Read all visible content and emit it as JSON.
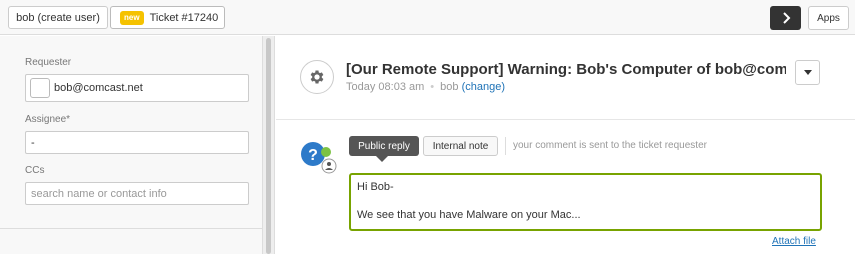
{
  "topbar": {
    "user_tab_label": "bob (create user)",
    "ticket_badge": "new",
    "ticket_tab_label": "Ticket #17240",
    "apps_label": "Apps"
  },
  "sidebar": {
    "requester_label": "Requester",
    "requester_value": "bob@comcast.net",
    "assignee_label": "Assignee*",
    "assignee_value": "-",
    "ccs_label": "CCs",
    "ccs_placeholder": "search name or contact info"
  },
  "ticket": {
    "subject": "[Our Remote Support] Warning: Bob's Computer of bob@comcast.n...",
    "timestamp": "Today 08:03 am",
    "author": "bob",
    "change_link": "(change)"
  },
  "composer": {
    "public_reply_label": "Public reply",
    "internal_note_label": "Internal note",
    "hint": "your comment is sent to the ticket requester",
    "body_line1": "Hi Bob-",
    "body_line2": "We see that you have Malware on your Mac...",
    "attach_label": "Attach file"
  },
  "colors": {
    "accent_green": "#78a300",
    "link_blue": "#1f73b7",
    "badge_yellow": "#f5c200"
  },
  "icons": [
    "chevron-right-icon",
    "gear-icon",
    "caret-down-icon",
    "help-question-icon"
  ]
}
